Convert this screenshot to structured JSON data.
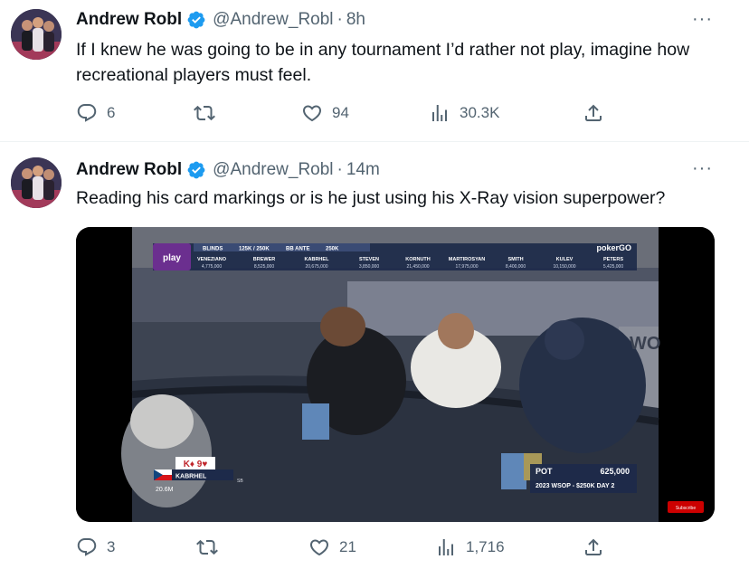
{
  "tweets": [
    {
      "name": "Andrew Robl",
      "handle": "@Andrew_Robl",
      "separator": "·",
      "time": "8h",
      "text": "If I knew he was going to be in any tournament I’d rather not play, imagine how recreational players must feel.",
      "more": "···",
      "replies": "6",
      "retweets": "",
      "likes": "94",
      "views": "30.3K"
    },
    {
      "name": "Andrew Robl",
      "handle": "@Andrew_Robl",
      "separator": "·",
      "time": "14m",
      "text": "Reading his card markings or is he just using his X-Ray vision superpower?",
      "more": "···",
      "replies": "3",
      "retweets": "",
      "likes": "21",
      "views": "1,716"
    }
  ],
  "media": {
    "overlay": {
      "play_logo": "play",
      "blinds_label": "BLINDS",
      "blinds_value": "125K / 250K",
      "bb_ante_label": "BB ANTE",
      "bb_ante_value": "250K",
      "pokergo": "pokerGO",
      "players": [
        {
          "name": "VENEZIANO",
          "stack": "4,775,000"
        },
        {
          "name": "BREWER",
          "stack": "8,525,000"
        },
        {
          "name": "KABRHEL",
          "stack": "20,675,000"
        },
        {
          "name": "STEVEN",
          "stack": "3,850,000"
        },
        {
          "name": "KORNUTH",
          "stack": "21,450,000"
        },
        {
          "name": "MARTIROSYAN",
          "stack": "17,975,000"
        },
        {
          "name": "SMITH",
          "stack": "8,400,000"
        },
        {
          "name": "KULEV",
          "stack": "10,150,000"
        },
        {
          "name": "PETERS",
          "stack": "5,425,000"
        }
      ],
      "hole_cards": "K♦ 9♥",
      "player_name": "KABRHEL",
      "player_stack": "20.6M",
      "player_pos": "SB",
      "pot_label": "POT",
      "pot_value": "625,000",
      "event": "2023 WSOP - $250K DAY 2",
      "subscribe": "Subscribe",
      "wall_text": "WO"
    }
  },
  "colors": {
    "text": "#0f1419",
    "secondary": "#536471",
    "verified": "#1d9bf0",
    "divider": "#eff3f4",
    "overlay_purple": "#6b2f8f",
    "overlay_navy": "#1d2a4a"
  }
}
